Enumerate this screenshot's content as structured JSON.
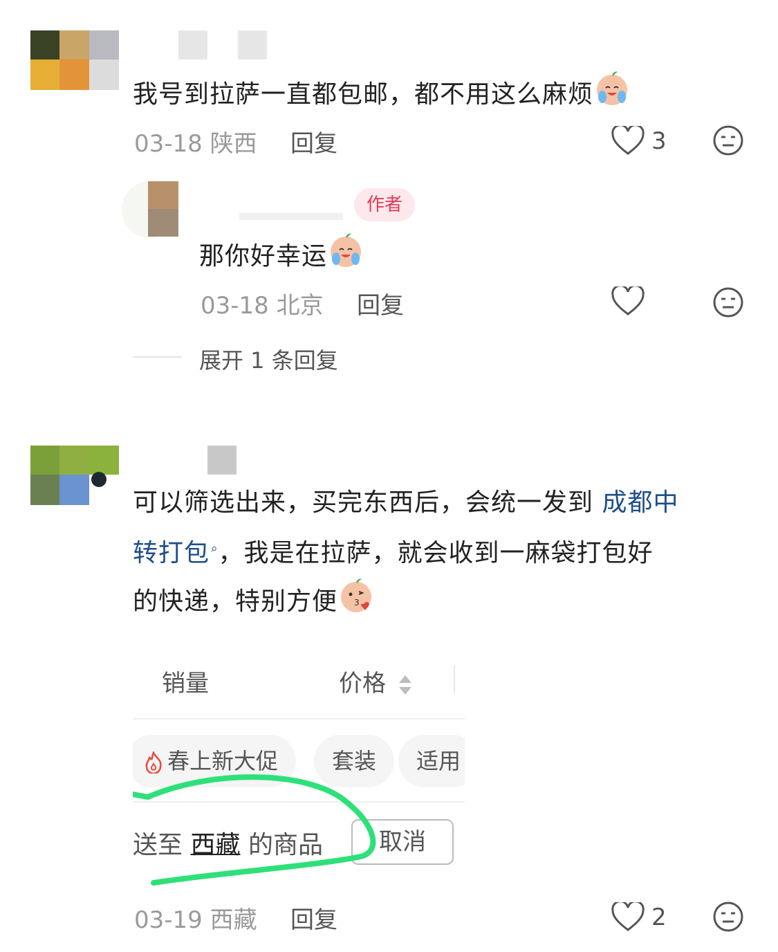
{
  "comments": [
    {
      "text": "我号到拉萨一直都包邮，都不用这么麻烦",
      "emoji": "crying-laugh-emoji",
      "date": "03-18",
      "location": "陕西",
      "reply_label": "回复",
      "likes": "3"
    }
  ],
  "reply": {
    "author_badge": "作者",
    "text": "那你好幸运",
    "emoji": "crying-laugh-emoji",
    "date": "03-18",
    "location": "北京",
    "reply_label": "回复"
  },
  "expand_replies": "展开 1 条回复",
  "comment2": {
    "text_line1_plain": "可以筛选出来，买完东西后，会统一发到 ",
    "text_link": "成都中",
    "text_link2": "转打包",
    "text_line2_rest": "，我是在拉萨，就会收到一麻袋打包好",
    "text_line3": "的快递，特别方便",
    "emoji": "kiss-emoji",
    "date": "03-19",
    "location": "西藏",
    "reply_label": "回复",
    "likes": "2"
  },
  "embedded_screenshot": {
    "sort_sales": "销量",
    "sort_price": "价格",
    "chip_promo": "春上新大促",
    "chip_set": "套装",
    "chip_apply": "适用",
    "ship_prefix": "送至",
    "ship_region": "西藏",
    "ship_suffix": "的商品",
    "cancel": "取消"
  },
  "colors": {
    "link": "#1f4e8c",
    "author_badge_bg": "#fde8ec",
    "author_badge_text": "#e33a55",
    "annotation_stroke": "#2ee07a"
  }
}
